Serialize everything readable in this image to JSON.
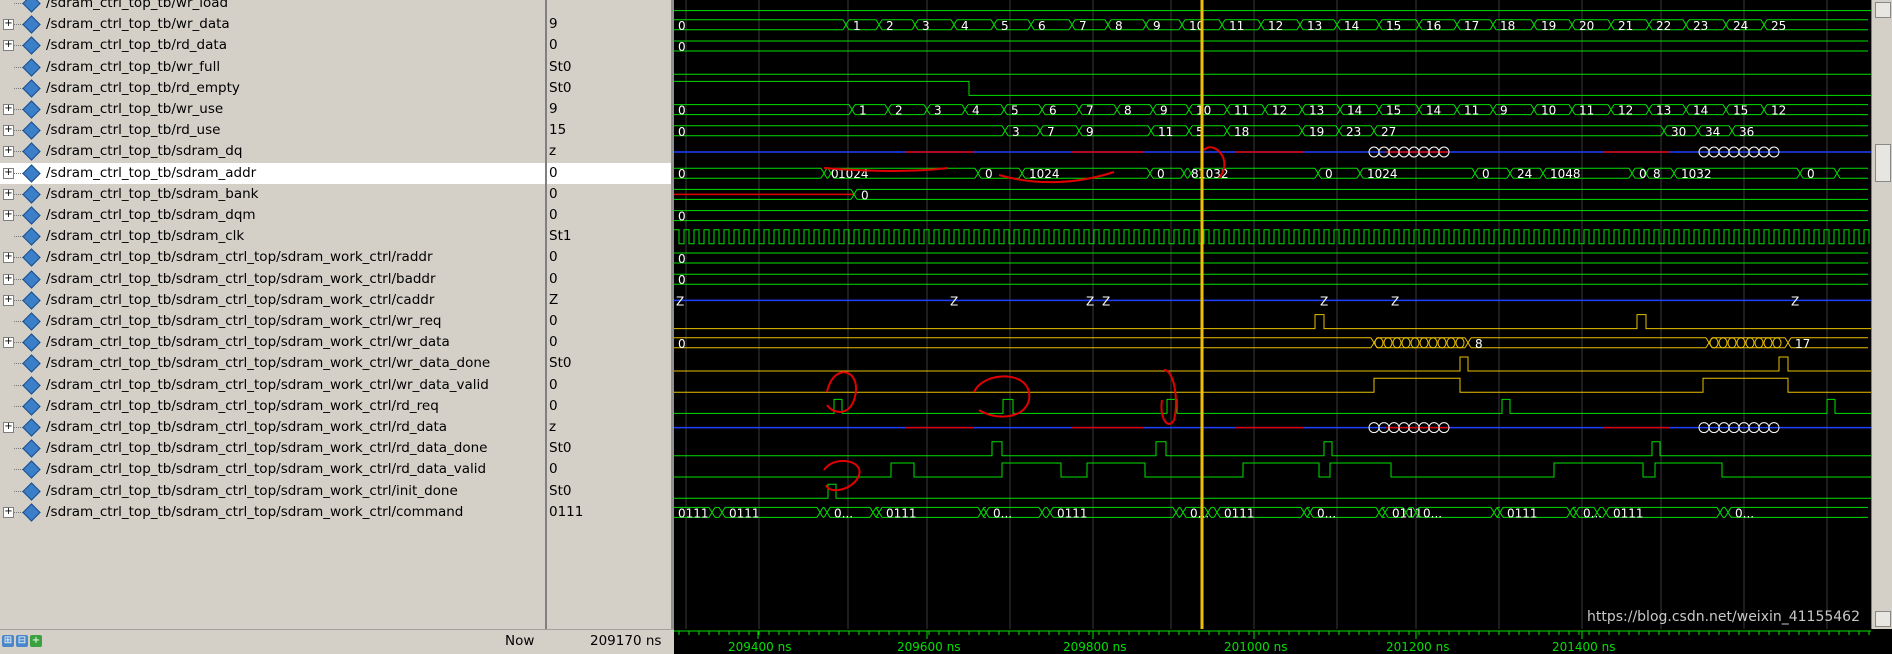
{
  "signals": [
    {
      "name": "/sdram_ctrl_top_tb/wr_load",
      "value": "",
      "expand": false,
      "color": "green"
    },
    {
      "name": "/sdram_ctrl_top_tb/wr_data",
      "value": "9",
      "expand": true,
      "color": "green"
    },
    {
      "name": "/sdram_ctrl_top_tb/rd_data",
      "value": "0",
      "expand": true,
      "color": "green"
    },
    {
      "name": "/sdram_ctrl_top_tb/wr_full",
      "value": "St0",
      "expand": false,
      "color": "green"
    },
    {
      "name": "/sdram_ctrl_top_tb/rd_empty",
      "value": "St0",
      "expand": false,
      "color": "green"
    },
    {
      "name": "/sdram_ctrl_top_tb/wr_use",
      "value": "9",
      "expand": true,
      "color": "green"
    },
    {
      "name": "/sdram_ctrl_top_tb/rd_use",
      "value": "15",
      "expand": true,
      "color": "green"
    },
    {
      "name": "/sdram_ctrl_top_tb/sdram_dq",
      "value": "z",
      "expand": true,
      "color": "blue"
    },
    {
      "name": "/sdram_ctrl_top_tb/sdram_addr",
      "value": "0",
      "expand": true,
      "color": "green",
      "selected": true
    },
    {
      "name": "/sdram_ctrl_top_tb/sdram_bank",
      "value": "0",
      "expand": true,
      "color": "green"
    },
    {
      "name": "/sdram_ctrl_top_tb/sdram_dqm",
      "value": "0",
      "expand": true,
      "color": "green"
    },
    {
      "name": "/sdram_ctrl_top_tb/sdram_clk",
      "value": "St1",
      "expand": false,
      "color": "green"
    },
    {
      "name": "/sdram_ctrl_top_tb/sdram_ctrl_top/sdram_work_ctrl/raddr",
      "value": "0",
      "expand": true,
      "color": "green"
    },
    {
      "name": "/sdram_ctrl_top_tb/sdram_ctrl_top/sdram_work_ctrl/baddr",
      "value": "0",
      "expand": true,
      "color": "green"
    },
    {
      "name": "/sdram_ctrl_top_tb/sdram_ctrl_top/sdram_work_ctrl/caddr",
      "value": "Z",
      "expand": true,
      "color": "blue"
    },
    {
      "name": "/sdram_ctrl_top_tb/sdram_ctrl_top/sdram_work_ctrl/wr_req",
      "value": "0",
      "expand": false,
      "color": "yellow"
    },
    {
      "name": "/sdram_ctrl_top_tb/sdram_ctrl_top/sdram_work_ctrl/wr_data",
      "value": "0",
      "expand": true,
      "color": "yellow"
    },
    {
      "name": "/sdram_ctrl_top_tb/sdram_ctrl_top/sdram_work_ctrl/wr_data_done",
      "value": "St0",
      "expand": false,
      "color": "yellow"
    },
    {
      "name": "/sdram_ctrl_top_tb/sdram_ctrl_top/sdram_work_ctrl/wr_data_valid",
      "value": "0",
      "expand": false,
      "color": "yellow"
    },
    {
      "name": "/sdram_ctrl_top_tb/sdram_ctrl_top/sdram_work_ctrl/rd_req",
      "value": "0",
      "expand": false,
      "color": "green"
    },
    {
      "name": "/sdram_ctrl_top_tb/sdram_ctrl_top/sdram_work_ctrl/rd_data",
      "value": "z",
      "expand": true,
      "color": "blue"
    },
    {
      "name": "/sdram_ctrl_top_tb/sdram_ctrl_top/sdram_work_ctrl/rd_data_done",
      "value": "St0",
      "expand": false,
      "color": "green"
    },
    {
      "name": "/sdram_ctrl_top_tb/sdram_ctrl_top/sdram_work_ctrl/rd_data_valid",
      "value": "0",
      "expand": false,
      "color": "green"
    },
    {
      "name": "/sdram_ctrl_top_tb/sdram_ctrl_top/sdram_work_ctrl/init_done",
      "value": "St0",
      "expand": false,
      "color": "green"
    },
    {
      "name": "/sdram_ctrl_top_tb/sdram_ctrl_top/sdram_work_ctrl/command",
      "value": "0111",
      "expand": true,
      "color": "green"
    }
  ],
  "footer": {
    "now_label": "Now",
    "now_value": "209170 ns"
  },
  "timeline": {
    "ticks": [
      "209400 ns",
      "209600 ns",
      "209800 ns",
      "201000 ns",
      "201200 ns",
      "201400 ns"
    ]
  },
  "colors": {
    "green": "#00e000",
    "yellow": "#e8c000",
    "blue": "#2040ff",
    "red": "#e00000",
    "cursor": "#f0c000"
  },
  "bus_labels": {
    "wr_data": [
      "0",
      "1",
      "2",
      "3",
      "4",
      "5",
      "6",
      "7",
      "8",
      "9",
      "10",
      "11",
      "12",
      "13",
      "14",
      "15",
      "16",
      "17",
      "18",
      "19",
      "20",
      "21",
      "22",
      "23",
      "24",
      "25"
    ],
    "wr_use": [
      "0",
      "1",
      "2",
      "3",
      "4",
      "5",
      "6",
      "7",
      "8",
      "9",
      "10",
      "11",
      "12",
      "13",
      "14",
      "15",
      "14",
      "11",
      "9",
      "10",
      "11",
      "12",
      "13",
      "14",
      "15",
      "12"
    ],
    "rd_use": [
      "0",
      "3",
      "7",
      "9",
      "11",
      "5",
      "18",
      "19",
      "23",
      "27",
      "30",
      "34",
      "36"
    ],
    "sdram_addr": [
      "0",
      "0",
      "1024",
      "0",
      "1024",
      "0",
      "8",
      "1032",
      "0",
      "1024",
      "0",
      "24",
      "1048",
      "0",
      "8",
      "1032",
      "0"
    ],
    "sdram_bank": [
      "0"
    ],
    "sdram_dqm": [
      "0"
    ],
    "raddr": [
      "0"
    ],
    "baddr": [
      "0"
    ],
    "caddr": [
      "Z",
      "Z",
      "Z",
      "Z",
      "Z",
      "Z",
      "Z"
    ],
    "sub_wr_data": [
      "0",
      "8",
      "17"
    ],
    "command": [
      "0111",
      "0111",
      "0...",
      "0111",
      "0...",
      "0111",
      "0...",
      "0111",
      "0...",
      "0111",
      "0...",
      "0111",
      "0...",
      "0111",
      "0..."
    ]
  },
  "watermark": "https://blog.csdn.net/weixin_41155462"
}
